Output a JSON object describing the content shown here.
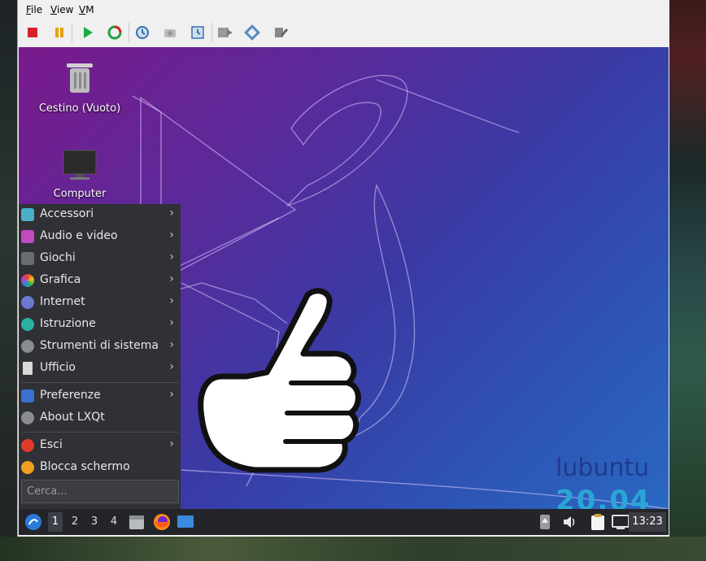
{
  "menubar": {
    "items": [
      {
        "label": "File",
        "hotkey": "F",
        "rest": "ile"
      },
      {
        "label": "View",
        "hotkey": "V",
        "rest": "iew"
      },
      {
        "label": "VM",
        "hotkey": "V",
        "rest": "M"
      }
    ]
  },
  "toolbar": {
    "icons": [
      "stop-icon",
      "pause-icon",
      "play-icon",
      "reset-icon",
      "snapshot-icon",
      "snapshot-disabled-icon",
      "snapshot-manager-icon",
      "send-keys-icon",
      "settings-icon",
      "tools-icon"
    ]
  },
  "desktop": {
    "icons": [
      {
        "label": "Cestino (Vuoto)",
        "icon": "trash-icon"
      },
      {
        "label": "Computer",
        "icon": "computer-icon"
      }
    ],
    "branding": {
      "name": "lubuntu",
      "version": "20.04"
    }
  },
  "start_menu": {
    "items": [
      {
        "label": "Accessori",
        "submenu": true,
        "color": "#4ab0c8"
      },
      {
        "label": "Audio e video",
        "submenu": true,
        "color": "#c04ac0"
      },
      {
        "label": "Giochi",
        "submenu": true,
        "color": "#6a6c70"
      },
      {
        "label": "Grafica",
        "submenu": true,
        "color": "#e86a2a"
      },
      {
        "label": "Internet",
        "submenu": true,
        "color": "#6a7ad0"
      },
      {
        "label": "Istruzione",
        "submenu": true,
        "color": "#2ab0a0"
      },
      {
        "label": "Strumenti di sistema",
        "submenu": true,
        "color": "#8a8c90"
      },
      {
        "label": "Ufficio",
        "submenu": true,
        "color": "#d8d8d8"
      }
    ],
    "items2": [
      {
        "label": "Preferenze",
        "submenu": true,
        "color": "#3a70d0"
      },
      {
        "label": "About LXQt",
        "submenu": false,
        "color": "#8a8c90"
      }
    ],
    "items3": [
      {
        "label": "Esci",
        "submenu": true,
        "color": "#e03a2a"
      },
      {
        "label": "Blocca schermo",
        "submenu": false,
        "color": "#f0a020"
      }
    ],
    "search_placeholder": "Cerca..."
  },
  "taskbar": {
    "workspaces": [
      "1",
      "2",
      "3",
      "4"
    ],
    "active_workspace": "1",
    "clock": "13:23"
  }
}
